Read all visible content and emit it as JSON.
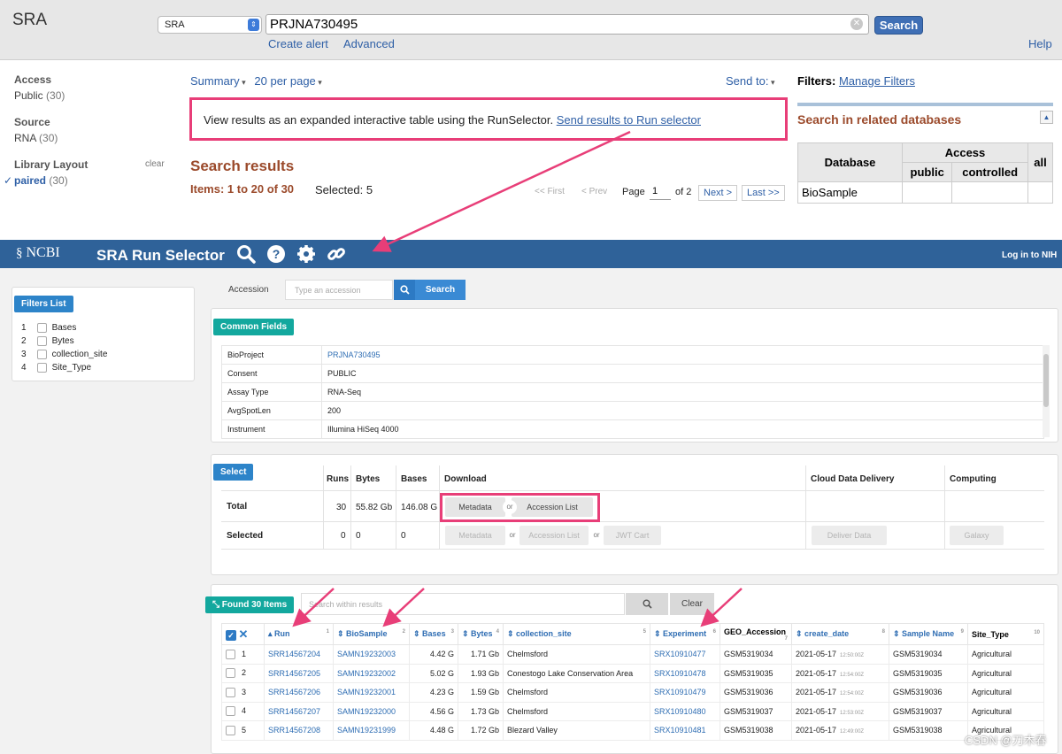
{
  "sra": {
    "logo": "SRA",
    "db_select": "SRA",
    "search_term": "PRJNA730495",
    "search_button": "Search",
    "create_alert": "Create alert",
    "advanced": "Advanced",
    "help": "Help",
    "facets": [
      {
        "heading": "Access",
        "value": "Public",
        "count": "(30)"
      },
      {
        "heading": "Source",
        "value": "RNA",
        "count": "(30)"
      },
      {
        "heading": "Library Layout",
        "value": "paired",
        "count": "(30)",
        "clear": "clear",
        "checked": "✓"
      }
    ],
    "summary": "Summary",
    "per_page": "20 per page",
    "send_to": "Send to:",
    "run_selector_text": "View results as an expanded interactive table using the RunSelector.",
    "run_selector_link": "Send results to Run selector",
    "results_heading": "Search results",
    "items": "Items: 1 to 20 of 30",
    "selected": "Selected: 5",
    "pager": {
      "first": "<< First",
      "prev": "< Prev",
      "page_label": "Page",
      "page": "1",
      "of": "of 2",
      "next": "Next >",
      "last": "Last >>"
    },
    "filters_label": "Filters:",
    "manage_filters": "Manage Filters",
    "related_heading": "Search in related databases",
    "related_table": {
      "database": "Database",
      "access": "Access",
      "public": "public",
      "controlled": "controlled",
      "all": "all",
      "row": "BioSample"
    }
  },
  "run_selector": {
    "ncbi": "NCBI",
    "title": "SRA Run Selector",
    "login": "Log in to NIH",
    "accession_label": "Accession",
    "accession_placeholder": "Type an accession",
    "search": "Search",
    "filters_tag": "Filters List",
    "filters": [
      {
        "n": "1",
        "label": "Bases"
      },
      {
        "n": "2",
        "label": "Bytes"
      },
      {
        "n": "3",
        "label": "collection_site"
      },
      {
        "n": "4",
        "label": "Site_Type"
      }
    ],
    "common_fields_tag": "Common Fields",
    "common_fields": [
      {
        "k": "BioProject",
        "v": "PRJNA730495"
      },
      {
        "k": "Consent",
        "v": "PUBLIC"
      },
      {
        "k": "Assay Type",
        "v": "RNA-Seq"
      },
      {
        "k": "AvgSpotLen",
        "v": "200"
      },
      {
        "k": "Instrument",
        "v": "Illumina HiSeq 4000"
      }
    ],
    "select_tag": "Select",
    "select_headers": {
      "runs": "Runs",
      "bytes": "Bytes",
      "bases": "Bases",
      "download": "Download",
      "cloud": "Cloud Data Delivery",
      "computing": "Computing"
    },
    "total": {
      "label": "Total",
      "runs": "30",
      "bytes": "55.82 Gb",
      "bases": "146.08 G"
    },
    "selected": {
      "label": "Selected",
      "runs": "0",
      "bytes": "0",
      "bases": "0"
    },
    "buttons": {
      "metadata": "Metadata",
      "or": "or",
      "accession_list": "Accession List",
      "jwt_cart": "JWT Cart",
      "deliver": "Deliver Data",
      "galaxy": "Galaxy"
    },
    "found_tag": "Found 30 Items",
    "search_within": "Search within results",
    "clear": "Clear",
    "columns": [
      {
        "label": "Run",
        "n": "1"
      },
      {
        "label": "BioSample",
        "n": "2"
      },
      {
        "label": "Bases",
        "n": "3"
      },
      {
        "label": "Bytes",
        "n": "4"
      },
      {
        "label": "collection_site",
        "n": "5"
      },
      {
        "label": "Experiment",
        "n": "6"
      },
      {
        "label": "GEO_Accession",
        "n": "7"
      },
      {
        "label": "create_date",
        "n": "8"
      },
      {
        "label": "Sample Name",
        "n": "9"
      },
      {
        "label": "Site_Type",
        "n": "10"
      }
    ],
    "rows": [
      {
        "i": "1",
        "run": "SRR14567204",
        "biosample": "SAMN19232003",
        "bases": "4.42 G",
        "bytes": "1.71 Gb",
        "site": "Chelmsford",
        "exp": "SRX10910477",
        "geo": "GSM5319034",
        "date": "2021-05-17",
        "time": "12:50:00Z",
        "sample": "GSM5319034",
        "type": "Agricultural"
      },
      {
        "i": "2",
        "run": "SRR14567205",
        "biosample": "SAMN19232002",
        "bases": "5.02 G",
        "bytes": "1.93 Gb",
        "site": "Conestogo Lake Conservation Area",
        "exp": "SRX10910478",
        "geo": "GSM5319035",
        "date": "2021-05-17",
        "time": "12:54:00Z",
        "sample": "GSM5319035",
        "type": "Agricultural"
      },
      {
        "i": "3",
        "run": "SRR14567206",
        "biosample": "SAMN19232001",
        "bases": "4.23 G",
        "bytes": "1.59 Gb",
        "site": "Chelmsford",
        "exp": "SRX10910479",
        "geo": "GSM5319036",
        "date": "2021-05-17",
        "time": "12:54:00Z",
        "sample": "GSM5319036",
        "type": "Agricultural"
      },
      {
        "i": "4",
        "run": "SRR14567207",
        "biosample": "SAMN19232000",
        "bases": "4.56 G",
        "bytes": "1.73 Gb",
        "site": "Chelmsford",
        "exp": "SRX10910480",
        "geo": "GSM5319037",
        "date": "2021-05-17",
        "time": "12:53:00Z",
        "sample": "GSM5319037",
        "type": "Agricultural"
      },
      {
        "i": "5",
        "run": "SRR14567208",
        "biosample": "SAMN19231999",
        "bases": "4.48 G",
        "bytes": "1.72 Gb",
        "site": "Blezard Valley",
        "exp": "SRX10910481",
        "geo": "GSM5319038",
        "date": "2021-05-17",
        "time": "12:49:00Z",
        "sample": "GSM5319038",
        "type": "Agricultural"
      }
    ]
  },
  "watermark": "CSDN @刀木春"
}
